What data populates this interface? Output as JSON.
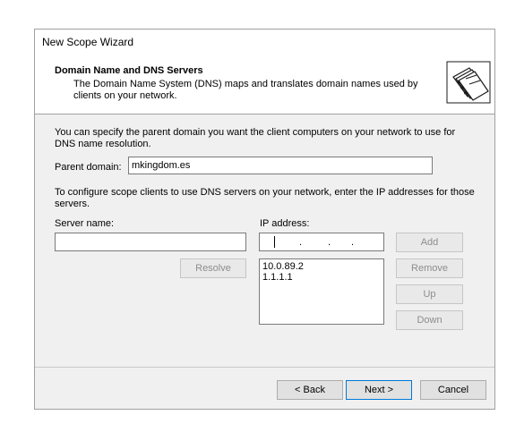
{
  "window": {
    "title": "New Scope Wizard"
  },
  "header": {
    "title": "Domain Name and DNS Servers",
    "description": "The Domain Name System (DNS) maps and translates domain names used by clients on your network.",
    "icon": "address-book-icon"
  },
  "intro_text": "You can specify the parent domain you want the client computers on your network to use for DNS name resolution.",
  "parent_domain": {
    "label": "Parent domain:",
    "value": "mkingdom.es"
  },
  "configure_text": "To configure scope clients to use DNS servers on your network, enter the IP addresses for those servers.",
  "server_name": {
    "label": "Server name:",
    "value": ""
  },
  "ip_address": {
    "label": "IP address:",
    "value": ""
  },
  "buttons": {
    "resolve": "Resolve",
    "add": "Add",
    "remove": "Remove",
    "up": "Up",
    "down": "Down"
  },
  "ip_list": [
    "10.0.89.2",
    "1.1.1.1"
  ],
  "footer": {
    "back": "< Back",
    "next": "Next >",
    "cancel": "Cancel"
  }
}
